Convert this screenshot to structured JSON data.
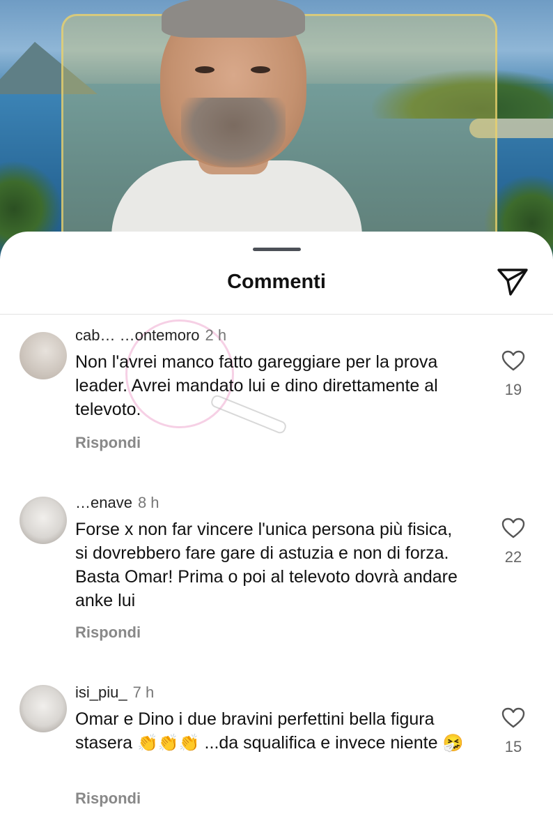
{
  "sheet": {
    "title": "Commenti",
    "send_icon": "send-icon",
    "handle_icon": "drag-handle"
  },
  "comments": [
    {
      "username": "cab… …ontemoro",
      "time": "2 h",
      "text": "Non l'avrei manco fatto gareggiare per la prova leader. Avrei mandato lui e dino direttamente al televoto.",
      "likes": "19",
      "reply_label": "Rispondi"
    },
    {
      "username": "…enave",
      "time": "8 h",
      "text": "Forse x non far vincere l'unica persona più fisica, si dovrebbero fare gare di astuzia e non di forza. Basta Omar! Prima o poi al televoto dovrà andare anke lui",
      "likes": "22",
      "reply_label": "Rispondi"
    },
    {
      "username": "isi_piu_",
      "time": "7 h",
      "text_before": "Omar e Dino i due bravini perfettini bella figura stasera",
      "clap_emojis": "👏👏👏",
      "text_after": "...da squalifica e invece niente",
      "end_emoji": "🤧",
      "likes": "15",
      "reply_label": "Rispondi"
    }
  ],
  "icons": {
    "like": "heart-outline-icon",
    "send": "paper-plane-icon"
  },
  "colors": {
    "text": "#111111",
    "secondary": "#888888",
    "divider": "#e2e2e2",
    "handle": "#4c5057"
  }
}
